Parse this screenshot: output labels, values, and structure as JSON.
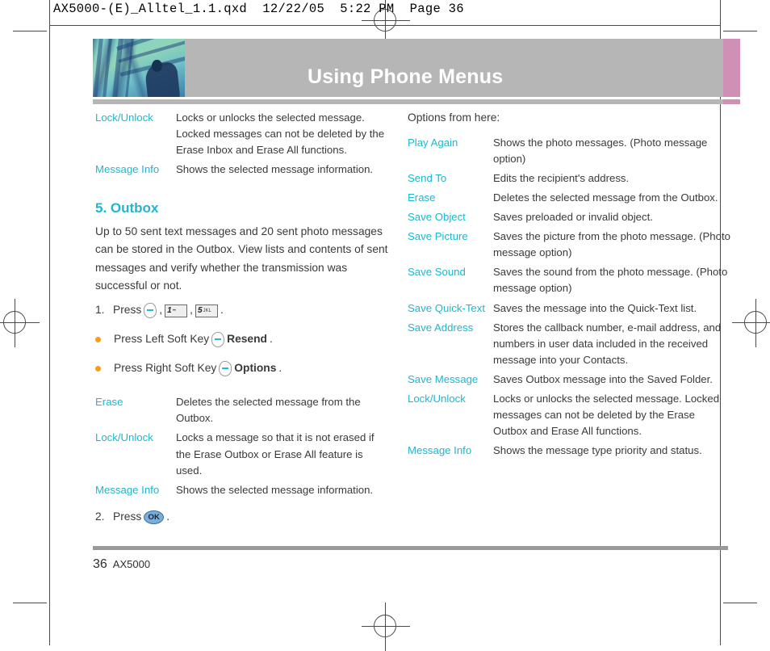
{
  "slug": "AX5000-(E)_Alltel_1.1.qxd  12/22/05  5:22 PM  Page 36",
  "header": {
    "title": "Using Phone Menus"
  },
  "left_column": {
    "top_table": [
      {
        "term": "Lock/Unlock",
        "desc": "Locks or unlocks the selected message. Locked messages can not be deleted by the Erase Inbox and Erase All functions."
      },
      {
        "term": "Message Info",
        "desc": "Shows the selected message information."
      }
    ],
    "section_heading": "5. Outbox",
    "body_paragraph": "Up to 50 sent text messages and 20 sent photo messages can be stored in the Outbox. View lists and contents of sent messages and verify whether the transmission was successful or not.",
    "step1": {
      "number": "1.",
      "press_label": "Press",
      "comma": ",",
      "period": ".",
      "key1": "1",
      "key1_sub": "••",
      "key2": "5",
      "key2_sub": "JKL"
    },
    "bullets": [
      {
        "prefix": "Press Left Soft Key",
        "bold": "Resend",
        "suffix": ".",
        "side": "left"
      },
      {
        "prefix": "Press Right Soft Key",
        "bold": "Options",
        "suffix": ".",
        "side": "right"
      }
    ],
    "lower_table": [
      {
        "term": "Erase",
        "desc": "Deletes the selected message from the Outbox."
      },
      {
        "term": "Lock/Unlock",
        "desc": "Locks a message so that it is not erased if the Erase Outbox or Erase All feature is used."
      },
      {
        "term": "Message Info",
        "desc": "Shows the selected message information."
      }
    ],
    "step2": {
      "number": "2.",
      "press_label": "Press",
      "ok_label": "OK",
      "period": "."
    }
  },
  "right_column": {
    "intro": "Options from here:",
    "table": [
      {
        "term": "Play Again",
        "desc": "Shows the photo messages. (Photo message option)"
      },
      {
        "term": "Send To",
        "desc": "Edits the recipient's address."
      },
      {
        "term": "Erase",
        "desc": "Deletes the selected message from the Outbox."
      },
      {
        "term": "Save Object",
        "desc": "Saves preloaded or invalid object."
      },
      {
        "term": "Save Picture",
        "desc": "Saves the picture from the photo message. (Photo message option)"
      },
      {
        "term": "Save Sound",
        "desc": "Saves the sound from the photo message. (Photo message option)"
      },
      {
        "term": "Save Quick-Text",
        "desc": "Saves the message into the Quick-Text list."
      },
      {
        "term": "Save Address",
        "desc": "Stores the callback number, e-mail address, and numbers in user data included in the received message into your Contacts."
      },
      {
        "term": "Save Message",
        "desc": "Saves Outbox message into the Saved Folder."
      },
      {
        "term": "Lock/Unlock",
        "desc": "Locks or unlocks the selected message. Locked messages can not be deleted by the Erase Outbox and Erase All functions."
      },
      {
        "term": "Message Info",
        "desc": "Shows the message type priority and status."
      }
    ]
  },
  "footer": {
    "page_number": "36",
    "model": "AX5000"
  },
  "colors": {
    "accent_teal": "#1fb6d0",
    "bullet_orange": "#f5a019",
    "header_gray": "#b6b6b6",
    "header_pink": "#d08fb4",
    "body_text": "#3a3a3a"
  }
}
